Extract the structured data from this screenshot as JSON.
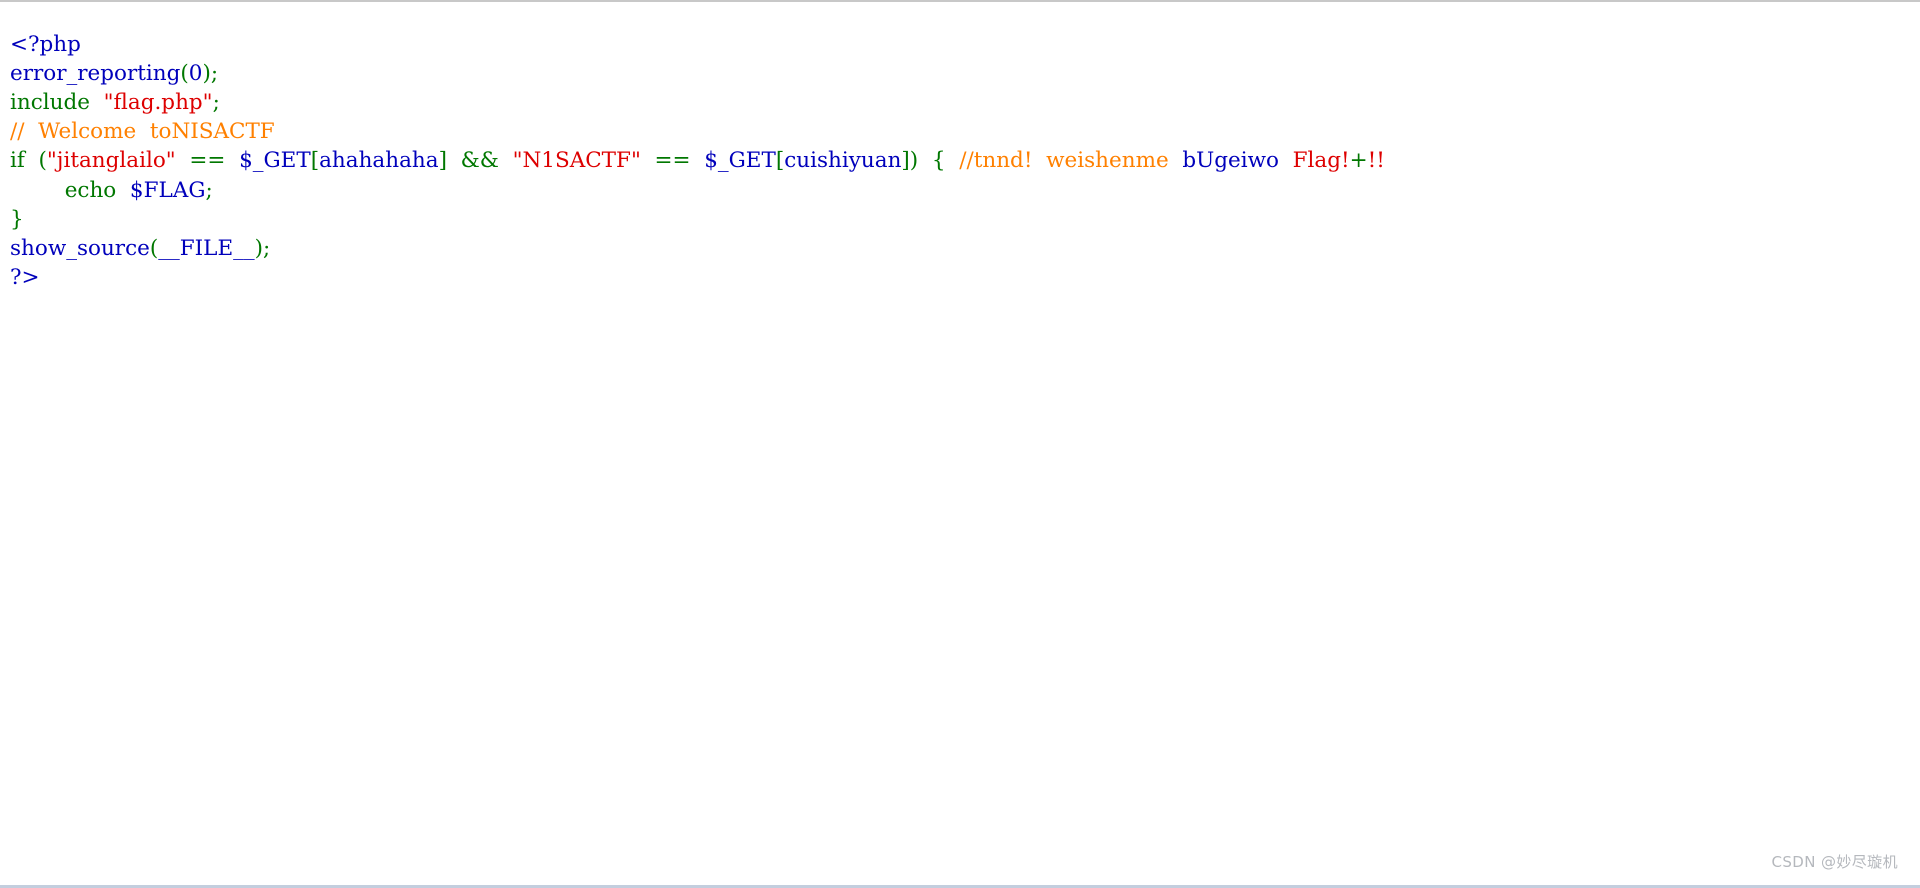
{
  "page": {
    "title": "PHP source listing (show_source output)",
    "background_color": "#ffffff",
    "top_rule_color": "#c8c8c8",
    "bottom_rule_color": "#c3cede"
  },
  "colors": {
    "default": "#0000bb",
    "keyword": "#007700",
    "string": "#dd0000",
    "comment": "#ff8000"
  },
  "source": {
    "language": "php",
    "lines": [
      {
        "id": "line-1",
        "tokens": [
          {
            "text": "<?php",
            "kind": "default"
          }
        ]
      },
      {
        "id": "line-2",
        "tokens": [
          {
            "text": "error_reporting",
            "kind": "default"
          },
          {
            "text": "(",
            "kind": "keyword"
          },
          {
            "text": "0",
            "kind": "default"
          },
          {
            "text": ")",
            "kind": "keyword"
          },
          {
            "text": ";",
            "kind": "keyword"
          }
        ]
      },
      {
        "id": "line-3",
        "tokens": [
          {
            "text": "include",
            "kind": "keyword"
          },
          {
            "text": "  ",
            "kind": "default"
          },
          {
            "text": "\"flag.php\"",
            "kind": "string"
          },
          {
            "text": ";",
            "kind": "keyword"
          }
        ]
      },
      {
        "id": "line-4",
        "tokens": [
          {
            "text": "//  Welcome  toNISACTF",
            "kind": "comment"
          }
        ]
      },
      {
        "id": "line-5",
        "tokens": [
          {
            "text": "if",
            "kind": "keyword"
          },
          {
            "text": "  ",
            "kind": "default"
          },
          {
            "text": "(",
            "kind": "keyword"
          },
          {
            "text": "\"jitanglailo\"",
            "kind": "string"
          },
          {
            "text": "  ",
            "kind": "default"
          },
          {
            "text": "==",
            "kind": "keyword"
          },
          {
            "text": "  ",
            "kind": "default"
          },
          {
            "text": "$_GET",
            "kind": "default"
          },
          {
            "text": "[",
            "kind": "keyword"
          },
          {
            "text": "ahahahaha",
            "kind": "default"
          },
          {
            "text": "]",
            "kind": "keyword"
          },
          {
            "text": "  ",
            "kind": "default"
          },
          {
            "text": "&&",
            "kind": "keyword"
          },
          {
            "text": "  ",
            "kind": "default"
          },
          {
            "text": "\"N1SACTF\"",
            "kind": "string"
          },
          {
            "text": "  ",
            "kind": "default"
          },
          {
            "text": "==",
            "kind": "keyword"
          },
          {
            "text": "  ",
            "kind": "default"
          },
          {
            "text": "$_GET",
            "kind": "default"
          },
          {
            "text": "[",
            "kind": "keyword"
          },
          {
            "text": "cuishiyuan",
            "kind": "default"
          },
          {
            "text": "])",
            "kind": "keyword"
          },
          {
            "text": "  ",
            "kind": "default"
          },
          {
            "text": "{",
            "kind": "keyword"
          },
          {
            "text": "  ",
            "kind": "default"
          },
          {
            "text": "//tnnd!  weishenme  ",
            "kind": "comment"
          },
          {
            "text": "bUgeiwo",
            "kind": "default"
          },
          {
            "text": "  ",
            "kind": "default"
          },
          {
            "text": "Flag!",
            "kind": "string"
          },
          {
            "text": "+",
            "kind": "keyword"
          },
          {
            "text": "!!",
            "kind": "string"
          }
        ]
      },
      {
        "id": "line-6",
        "tokens": [
          {
            "text": "        ",
            "kind": "default"
          },
          {
            "text": "echo",
            "kind": "keyword"
          },
          {
            "text": "  ",
            "kind": "default"
          },
          {
            "text": "$FLAG",
            "kind": "default"
          },
          {
            "text": ";",
            "kind": "keyword"
          }
        ]
      },
      {
        "id": "line-7",
        "tokens": [
          {
            "text": "}",
            "kind": "keyword"
          }
        ]
      },
      {
        "id": "line-8",
        "tokens": [
          {
            "text": "show_source",
            "kind": "default"
          },
          {
            "text": "(",
            "kind": "keyword"
          },
          {
            "text": "__FILE__",
            "kind": "default"
          },
          {
            "text": ")",
            "kind": "keyword"
          },
          {
            "text": ";",
            "kind": "keyword"
          }
        ]
      },
      {
        "id": "line-9",
        "tokens": [
          {
            "text": "?>",
            "kind": "default"
          }
        ]
      }
    ]
  },
  "watermark": {
    "text": "CSDN @妙尽璇机"
  }
}
